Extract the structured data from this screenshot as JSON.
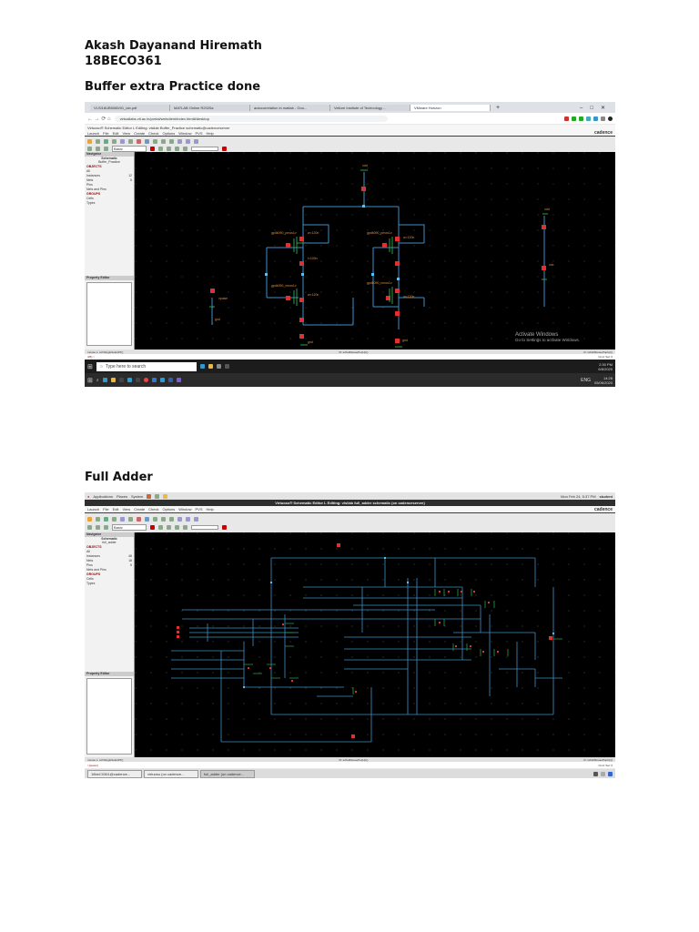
{
  "doc": {
    "author": "Akash Dayanand Hiremath",
    "roll": "18BECO361",
    "section1": "Buffer extra Practice done",
    "section2": "Full Adder"
  },
  "shot1": {
    "tabs": [
      "VLSI18UB5085/01_lab.pdf",
      "MATLAB Online R2020a",
      "autocorrelation in matlab - Goo...",
      "Vellore Institute of Technology ...",
      "VMware Horizon"
    ],
    "url": "virtuallabs.vit.ac.in/portal/webclient/index.html#/desktop",
    "title": "Virtuoso® Schematic Editor L Editing: vlsilab Buffer_Practice schematic@cadenceserver",
    "menu": [
      "Launch",
      "File",
      "Edit",
      "View",
      "Create",
      "Check",
      "Options",
      "Window",
      "PVS",
      "Help"
    ],
    "brand": "cadence",
    "search_combo": "Basic",
    "nav": {
      "header": "Navigator",
      "title": "Schematic",
      "cell": "Buffer_Practice",
      "objects": "OBJECTS",
      "items": [
        "All",
        "Instances",
        "Nets",
        "Pins",
        "Nets and Pins"
      ],
      "counts": [
        "",
        "12",
        "5",
        "",
        ""
      ],
      "groups": "GROUPS",
      "group_items": [
        "Cells",
        "Types"
      ]
    },
    "property_editor": "Property Editor",
    "status": {
      "left": "mouse L: schSingleSelectPt()",
      "mid": "M: schHiMousePopUp()",
      "right": "R: schHiMousePopUp()",
      "cmd": "Cmd: Sel: 0",
      "prompt": "4(5) >"
    },
    "watermark": {
      "title": "Activate Windows",
      "sub": "Go to Settings to activate Windows."
    },
    "taskbar": {
      "search": "Type here to search",
      "time1": "2:30 PM",
      "date1": "6/6/2020",
      "lang": "ENG",
      "time2": "14:26",
      "date2": "05/06/2020"
    },
    "labels": {
      "vdd": "vdd",
      "gnd": "gnd",
      "vin": "vpulse",
      "vdc": "vdc",
      "pmos": "gpdk090_pmos1v",
      "nmos": "gpdk090_nmos1v",
      "w": "w=120n",
      "l": "l=100n"
    }
  },
  "shot2": {
    "top": [
      "Applications",
      "Places",
      "System"
    ],
    "clock": "Mon Feb 24, 5:37 PM",
    "user": "student",
    "title": "Virtuoso® Schematic Editor L Editing: vlsilab full_adder schematic (on cadenceserver)",
    "menu": [
      "Launch",
      "File",
      "Edit",
      "View",
      "Create",
      "Check",
      "Options",
      "Window",
      "PVS",
      "Help"
    ],
    "brand": "cadence",
    "search_combo": "Basic",
    "nav": {
      "header": "Navigator",
      "title": "Schematic",
      "cell": "full_adder",
      "objects": "OBJECTS",
      "items": [
        "All",
        "Instances",
        "Nets",
        "Pins",
        "Nets and Pins"
      ],
      "counts": [
        "",
        "48",
        "18",
        "5",
        ""
      ],
      "groups": "GROUPS",
      "group_items": [
        "Cells",
        "Types"
      ]
    },
    "property_editor": "Property Editor",
    "status": {
      "left": "mouse L: schSingleSelectPt()",
      "mid": "M: schHiMousePopUp()",
      "right": "R: schHiMousePopUp()",
      "cmd": "Cmd: Sel: 0",
      "prompt": ">(power)"
    },
    "taskbar": [
      "18beC0361@cadence...",
      "virtuoso (on cadence...",
      "full_adder (on cadence..."
    ]
  }
}
